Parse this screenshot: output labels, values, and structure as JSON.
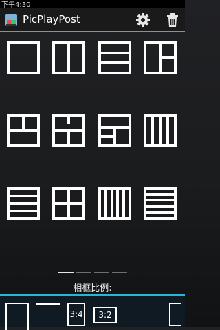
{
  "status_bar": {
    "time": "下午4:30"
  },
  "action_bar": {
    "app_title": "PicPlayPost"
  },
  "layouts": [
    "single",
    "two-vertical",
    "three-horizontal",
    "mixed-right",
    "big-left",
    "top-split",
    "left-big",
    "four-vertical",
    "five-horizontal",
    "four-grid",
    "five-vertical",
    "six-horizontal"
  ],
  "pager": {
    "pages": 4,
    "active_index": 0
  },
  "ratio_section": {
    "label": "相框比例:",
    "options": [
      "",
      "",
      "3:4",
      "3:2",
      ""
    ]
  },
  "colors": {
    "accent": "#2bb3d8",
    "background": "#1b1c1e"
  }
}
